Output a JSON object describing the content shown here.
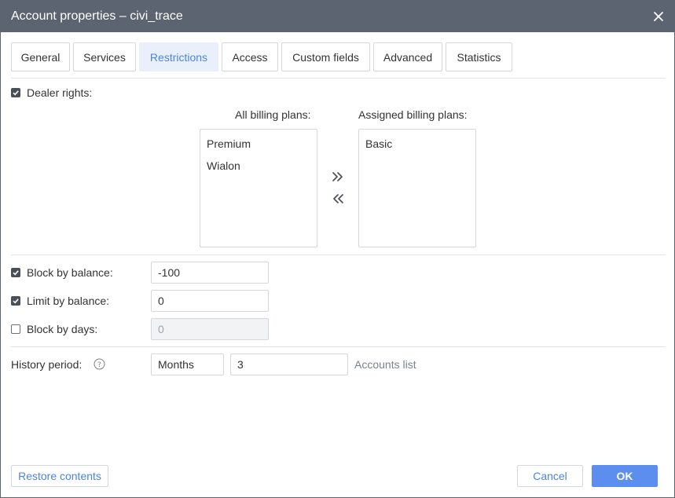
{
  "window": {
    "title": "Account properties – civi_trace",
    "close_icon": "close-icon"
  },
  "tabs": [
    {
      "label": "General",
      "active": false
    },
    {
      "label": "Services",
      "active": false
    },
    {
      "label": "Restrictions",
      "active": true
    },
    {
      "label": "Access",
      "active": false
    },
    {
      "label": "Custom fields",
      "active": false
    },
    {
      "label": "Advanced",
      "active": false
    },
    {
      "label": "Statistics",
      "active": false
    }
  ],
  "dealer": {
    "label": "Dealer rights:",
    "checked": true,
    "all_plans_label": "All billing plans:",
    "assigned_plans_label": "Assigned billing plans:",
    "all_plans": [
      "Premium",
      "Wialon"
    ],
    "assigned_plans": [
      "Basic"
    ],
    "move_right_icon": "double-chevron-right-icon",
    "move_left_icon": "double-chevron-left-icon"
  },
  "restrictions": {
    "block_by_balance": {
      "label": "Block by balance:",
      "checked": true,
      "value": "-100"
    },
    "limit_by_balance": {
      "label": "Limit by balance:",
      "checked": true,
      "value": "0"
    },
    "block_by_days": {
      "label": "Block by days:",
      "checked": false,
      "value": "0"
    }
  },
  "history": {
    "label": "History period:",
    "help_icon": "help-icon",
    "unit": "Months",
    "value": "3",
    "accounts_list": "Accounts list"
  },
  "footer": {
    "restore": "Restore contents",
    "cancel": "Cancel",
    "ok": "OK"
  },
  "colors": {
    "titlebar": "#5b6470",
    "accent": "#4c84e0",
    "primary_button": "#5c8ef0",
    "active_tab_bg": "#e9f0fc"
  }
}
